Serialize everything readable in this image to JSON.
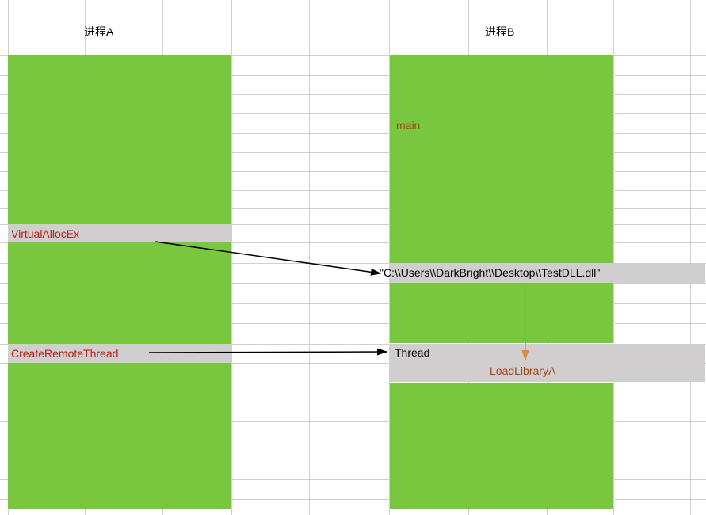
{
  "headers": {
    "proc_a": "进程A",
    "proc_b": "进程B"
  },
  "labels": {
    "main": "main",
    "virtual_alloc": "VirtualAllocEx",
    "create_remote_thread": "CreateRemoteThread",
    "thread": "Thread",
    "load_library": "LoadLibraryA",
    "path": "\"C:\\\\Users\\\\DarkBright\\\\Desktop\\\\TestDLL.dll\""
  },
  "grid": {
    "v_positions": [
      10,
      107,
      205,
      292,
      390,
      491,
      591,
      690,
      774,
      871
    ],
    "h_positions": [
      45,
      70,
      95,
      119,
      143,
      168,
      192,
      216,
      240,
      263,
      283,
      306,
      332,
      357,
      383,
      408,
      434,
      458,
      483,
      507,
      531,
      556,
      580,
      605,
      630
    ]
  }
}
